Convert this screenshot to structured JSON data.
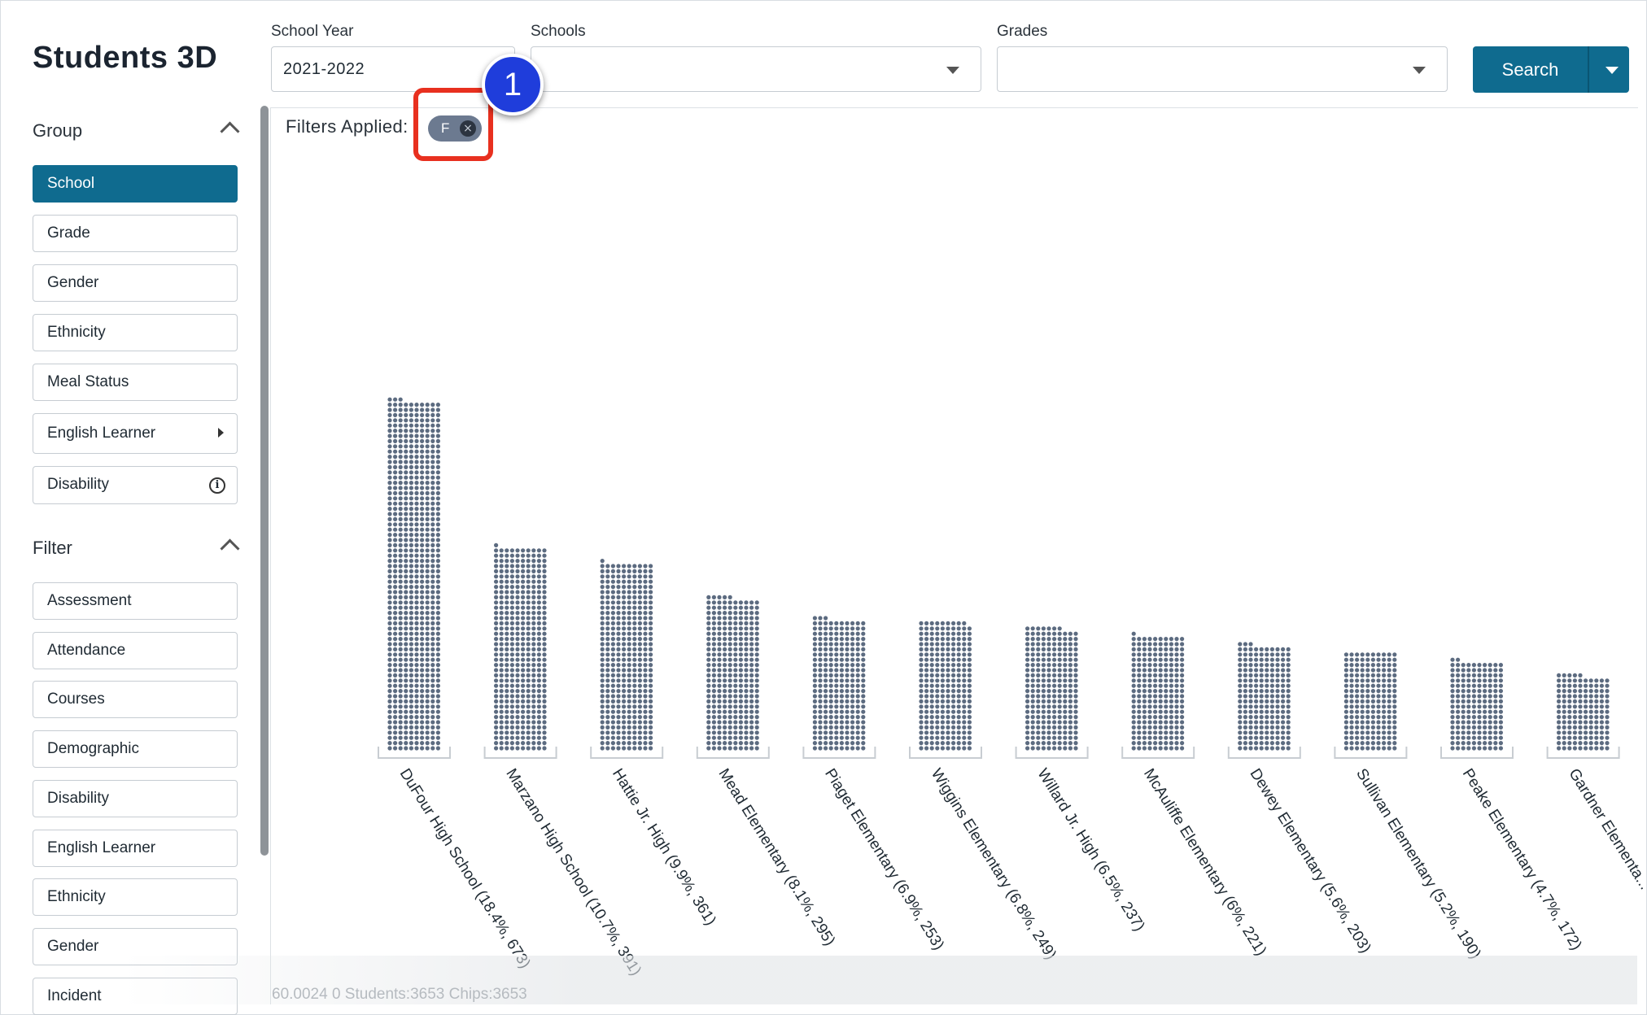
{
  "app": {
    "title": "Students 3D"
  },
  "sidebar": {
    "group": {
      "heading": "Group",
      "items": [
        {
          "label": "School",
          "active": true
        },
        {
          "label": "Grade"
        },
        {
          "label": "Gender"
        },
        {
          "label": "Ethnicity"
        },
        {
          "label": "Meal Status"
        },
        {
          "label": "English Learner",
          "has_submenu": true
        },
        {
          "label": "Disability",
          "has_info": true
        }
      ]
    },
    "filter": {
      "heading": "Filter",
      "items": [
        {
          "label": "Assessment"
        },
        {
          "label": "Attendance"
        },
        {
          "label": "Courses"
        },
        {
          "label": "Demographic"
        },
        {
          "label": "Disability"
        },
        {
          "label": "English Learner"
        },
        {
          "label": "Ethnicity"
        },
        {
          "label": "Gender"
        },
        {
          "label": "Incident"
        }
      ]
    }
  },
  "toolbar": {
    "school_year": {
      "label": "School Year",
      "value": "2021-2022"
    },
    "schools": {
      "label": "Schools",
      "value": ""
    },
    "grades": {
      "label": "Grades",
      "value": ""
    },
    "search_label": "Search"
  },
  "filters": {
    "label": "Filters Applied:",
    "chips": [
      {
        "label": "F"
      }
    ]
  },
  "annotation": {
    "step": "1"
  },
  "status_footer": "60.0024 0 Students:3653 Chips:3653",
  "colors": {
    "accent": "#0f6b8f",
    "dot": "#5c6b80",
    "chip": "#6c7a90",
    "highlight": "#e8301f",
    "badge": "#1f3ddb"
  },
  "chart_data": {
    "type": "bar",
    "categories": [
      "DuFour High School (18.4%, 673)",
      "Marzano High School (10.7%, 391)",
      "Hattie Jr. High (9.9%, 361)",
      "Mead Elementary (8.1%, 295)",
      "Piaget Elementary (6.9%, 253)",
      "Wiggins Elementary (6.8%, 249)",
      "Willard Jr. High (6.5%, 237)",
      "McAuliffe Elementary (6%, 221)",
      "Dewey Elementary (5.6%, 203)",
      "Sullivan Elementary (5.2%, 190)",
      "Peake Elementary (4.7%, 172)",
      "Gardner Elementa..."
    ],
    "values": [
      673,
      391,
      361,
      295,
      253,
      249,
      237,
      221,
      203,
      190,
      172,
      145
    ]
  }
}
